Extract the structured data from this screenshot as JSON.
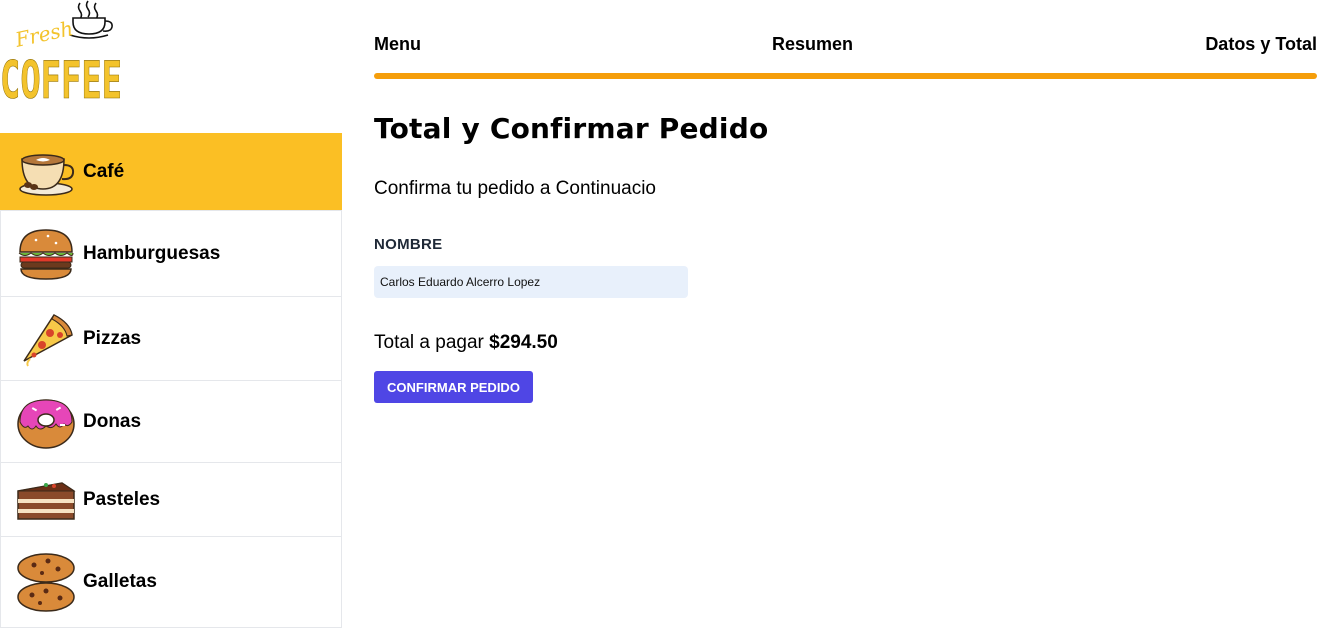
{
  "logo": {
    "line1": "Fresh",
    "line2": "COFFEE",
    "icon": "coffee-cup-icon",
    "color": "#f3c32c"
  },
  "sidebar": {
    "active_color": "#fbbf24",
    "items": [
      {
        "label": "Café",
        "icon": "coffee-cup-icon",
        "active": true
      },
      {
        "label": "Hamburguesas",
        "icon": "hamburger-icon",
        "active": false
      },
      {
        "label": "Pizzas",
        "icon": "pizza-slice-icon",
        "active": false
      },
      {
        "label": "Donas",
        "icon": "donut-icon",
        "active": false
      },
      {
        "label": "Pasteles",
        "icon": "cake-slice-icon",
        "active": false
      },
      {
        "label": "Galletas",
        "icon": "cookies-icon",
        "active": false
      }
    ]
  },
  "steps": {
    "items": [
      "Menu",
      "Resumen",
      "Datos y Total"
    ],
    "progress_fraction": 1.0,
    "progress_color": "#f59e0b"
  },
  "form": {
    "title": "Total y Confirmar Pedido",
    "subtitle": "Confirma tu pedido a Continuacio",
    "name_label": "NOMBRE",
    "name_value": "Carlos Eduardo Alcerro Lopez",
    "total_prefix": "Total a pagar",
    "total_amount": "$294.50",
    "confirm_label": "CONFIRMAR PEDIDO",
    "button_color": "#4f46e5"
  }
}
